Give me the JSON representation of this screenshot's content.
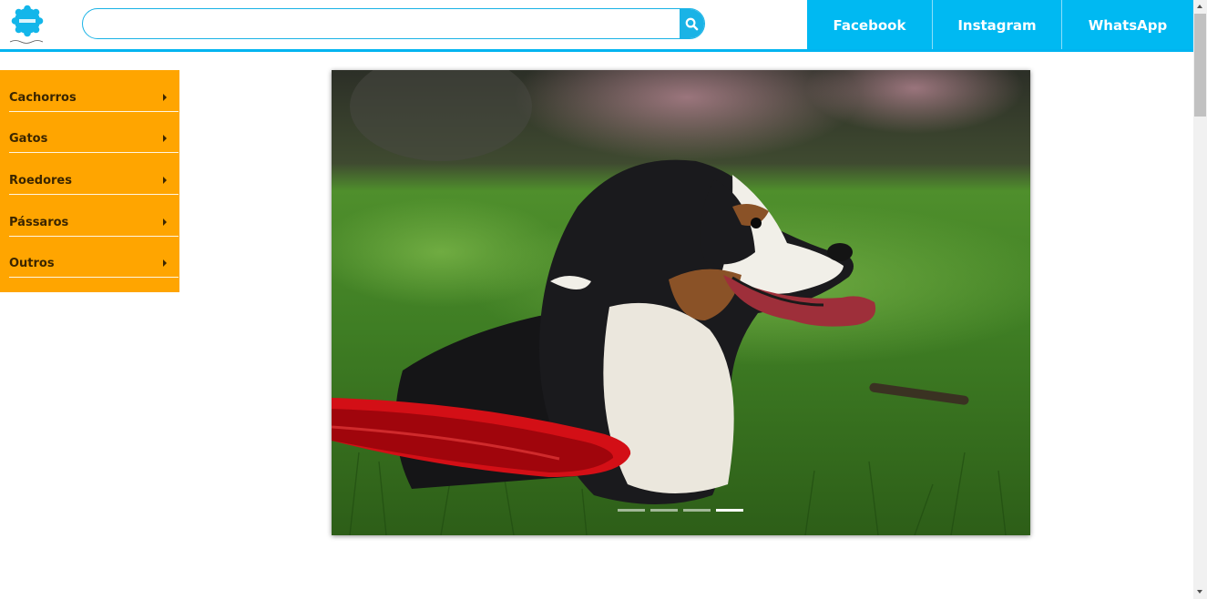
{
  "header": {
    "logo_icon": "animall-logo-icon",
    "search": {
      "value": "",
      "placeholder": "",
      "icon": "search-icon"
    },
    "social_links": [
      "Facebook",
      "Instagram",
      "WhatsApp"
    ]
  },
  "sidebar": {
    "items": [
      {
        "label": "Cachorros"
      },
      {
        "label": "Gatos"
      },
      {
        "label": "Roedores"
      },
      {
        "label": "Pássaros"
      },
      {
        "label": "Outros"
      }
    ],
    "expand_icon": "caret-right-icon"
  },
  "carousel": {
    "image": "dog-with-red-frisbee-photo",
    "slide_count": 4,
    "active_slide": 4
  },
  "colors": {
    "accent_blue": "#00b9f2",
    "sidebar_orange": "#ffa500",
    "menu_text": "#3a2500"
  }
}
